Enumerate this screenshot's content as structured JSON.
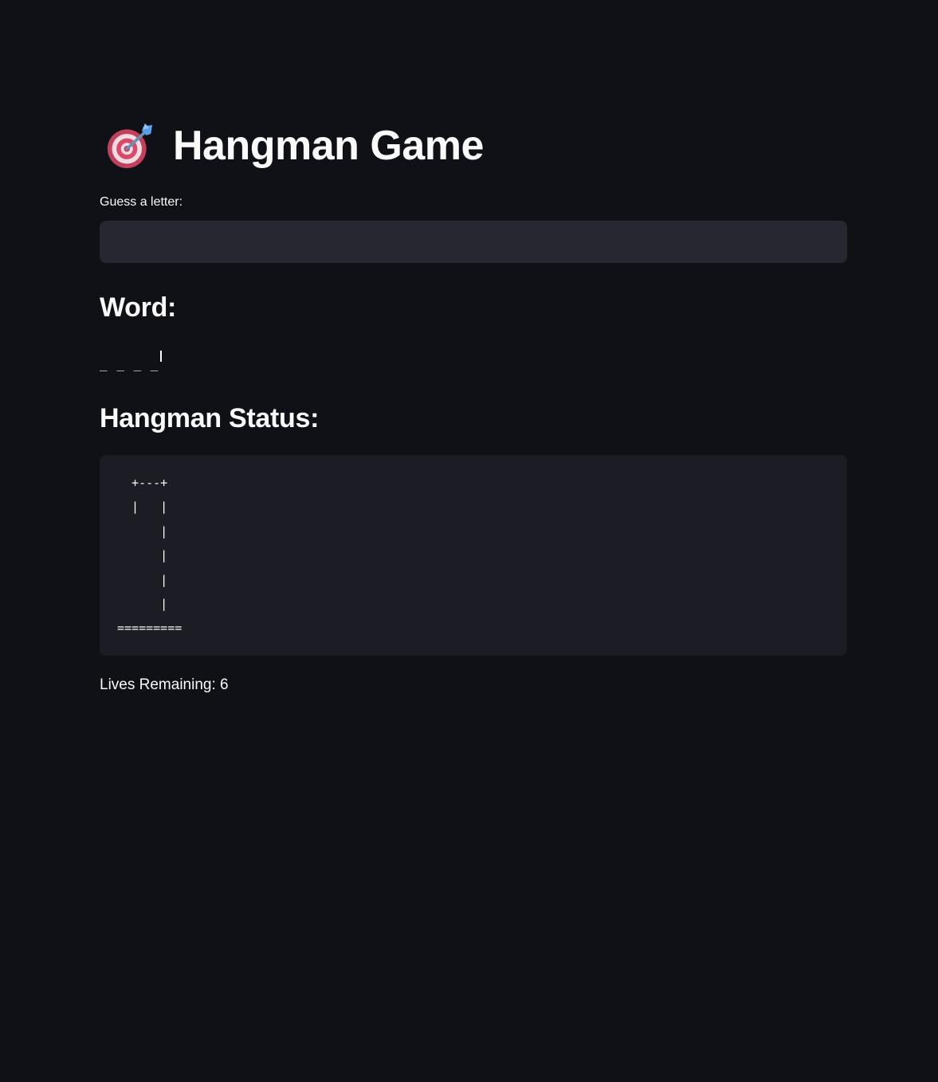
{
  "app": {
    "title": "Hangman Game",
    "title_icon": "dart-target-icon"
  },
  "guess_input": {
    "label": "Guess a letter:",
    "value": "",
    "placeholder": ""
  },
  "word_section": {
    "heading": "Word:",
    "display": "_ _ _ _"
  },
  "status_section": {
    "heading": "Hangman Status:",
    "ascii_art": "  +---+\n  |   |\n      |\n      |\n      |\n      |\n========="
  },
  "lives": {
    "text": "Lives Remaining: 6"
  },
  "colors": {
    "background": "#0f1116",
    "input_background": "#262730",
    "code_background": "#1b1c24",
    "text": "#fafafa"
  }
}
